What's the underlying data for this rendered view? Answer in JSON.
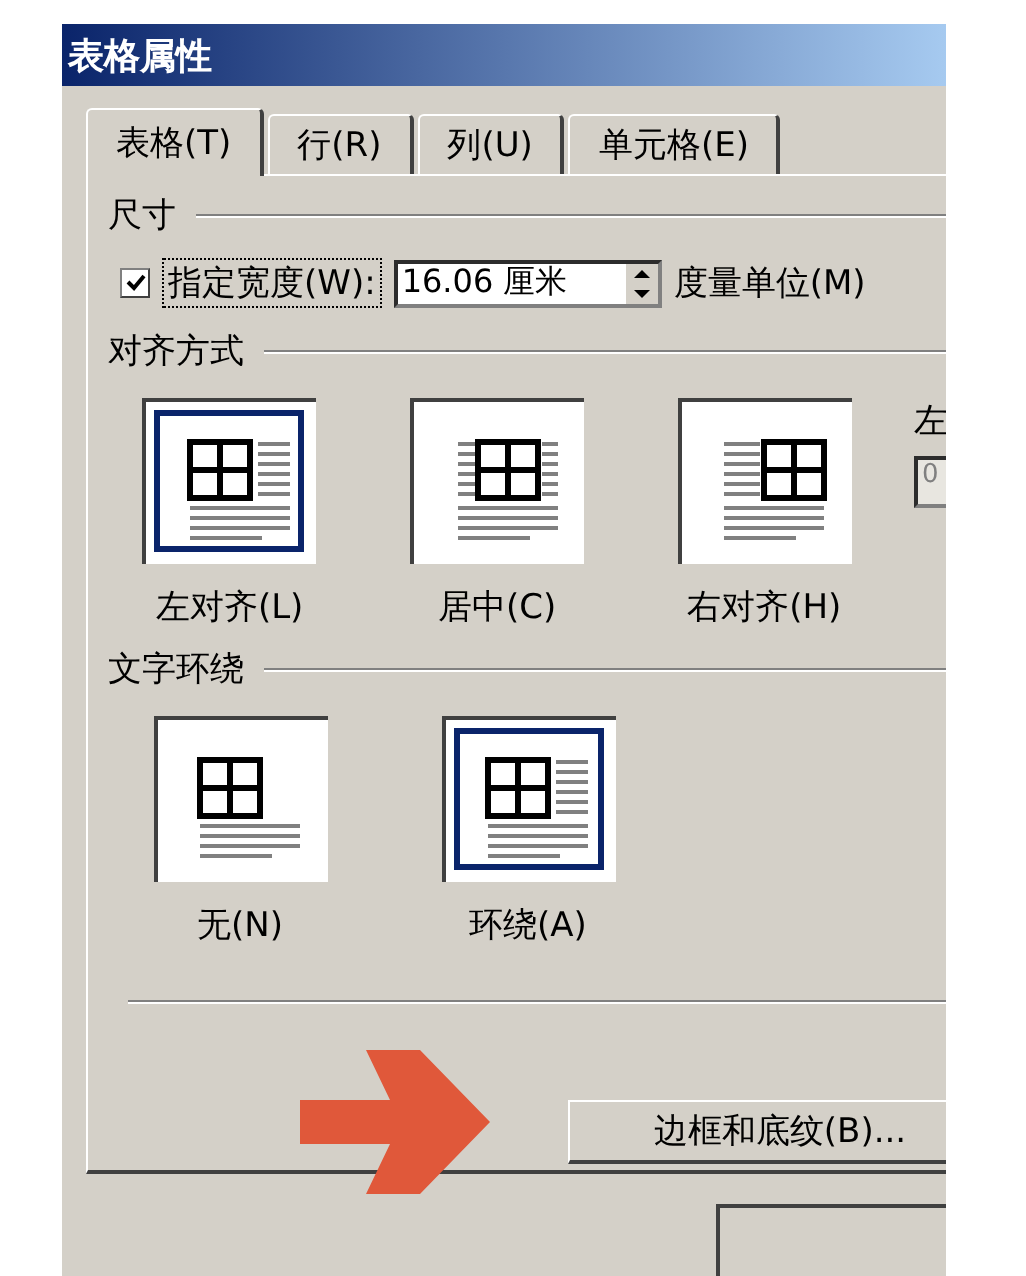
{
  "window": {
    "title": "表格属性"
  },
  "tabs": [
    {
      "label": "表格(T)",
      "selected": true
    },
    {
      "label": "行(R)",
      "selected": false
    },
    {
      "label": "列(U)",
      "selected": false
    },
    {
      "label": "单元格(E)",
      "selected": false
    }
  ],
  "size": {
    "heading": "尺寸",
    "width_checkbox": {
      "label": "指定宽度(W):",
      "checked": true
    },
    "width_field": {
      "value": "16.06 厘米"
    },
    "unit_label": "度量单位(M)"
  },
  "alignment": {
    "heading": "对齐方式",
    "options": [
      {
        "kind": "left",
        "label": "左对齐(L)",
        "selected": true
      },
      {
        "kind": "center",
        "label": "居中(C)",
        "selected": false
      },
      {
        "kind": "right",
        "label": "右对齐(H)",
        "selected": false
      }
    ],
    "indent_label": "左",
    "indent_field": {
      "value": "0"
    }
  },
  "wrapping": {
    "heading": "文字环绕",
    "options": [
      {
        "kind": "none",
        "label": "无(N)",
        "selected": false
      },
      {
        "kind": "around",
        "label": "环绕(A)",
        "selected": true
      }
    ]
  },
  "borders_button": "边框和底纹(B)..."
}
